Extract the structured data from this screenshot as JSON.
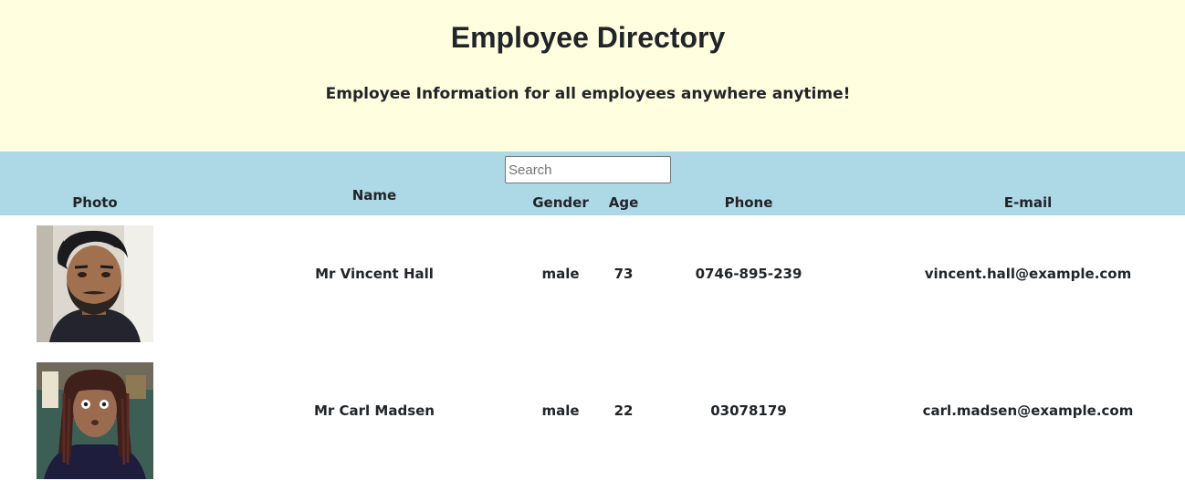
{
  "header": {
    "title": "Employee Directory",
    "subtitle": "Employee Information for all employees anywhere anytime!"
  },
  "search": {
    "placeholder": "Search",
    "value": ""
  },
  "table": {
    "columns": [
      "Photo",
      "Name",
      "Gender",
      "Age",
      "Phone",
      "E-mail"
    ],
    "rows": [
      {
        "photo": "portrait-man-dark-hair-beard",
        "name": "Mr Vincent Hall",
        "gender": "male",
        "age": "73",
        "phone": "0746-895-239",
        "email": "vincent.hall@example.com"
      },
      {
        "photo": "portrait-man-long-dreadlocks",
        "name": "Mr Carl Madsen",
        "gender": "male",
        "age": "22",
        "phone": "03078179",
        "email": "carl.madsen@example.com"
      }
    ]
  },
  "colors": {
    "header_bg": "#ffffdf",
    "table_header_bg": "#add8e6",
    "text": "#212529"
  }
}
